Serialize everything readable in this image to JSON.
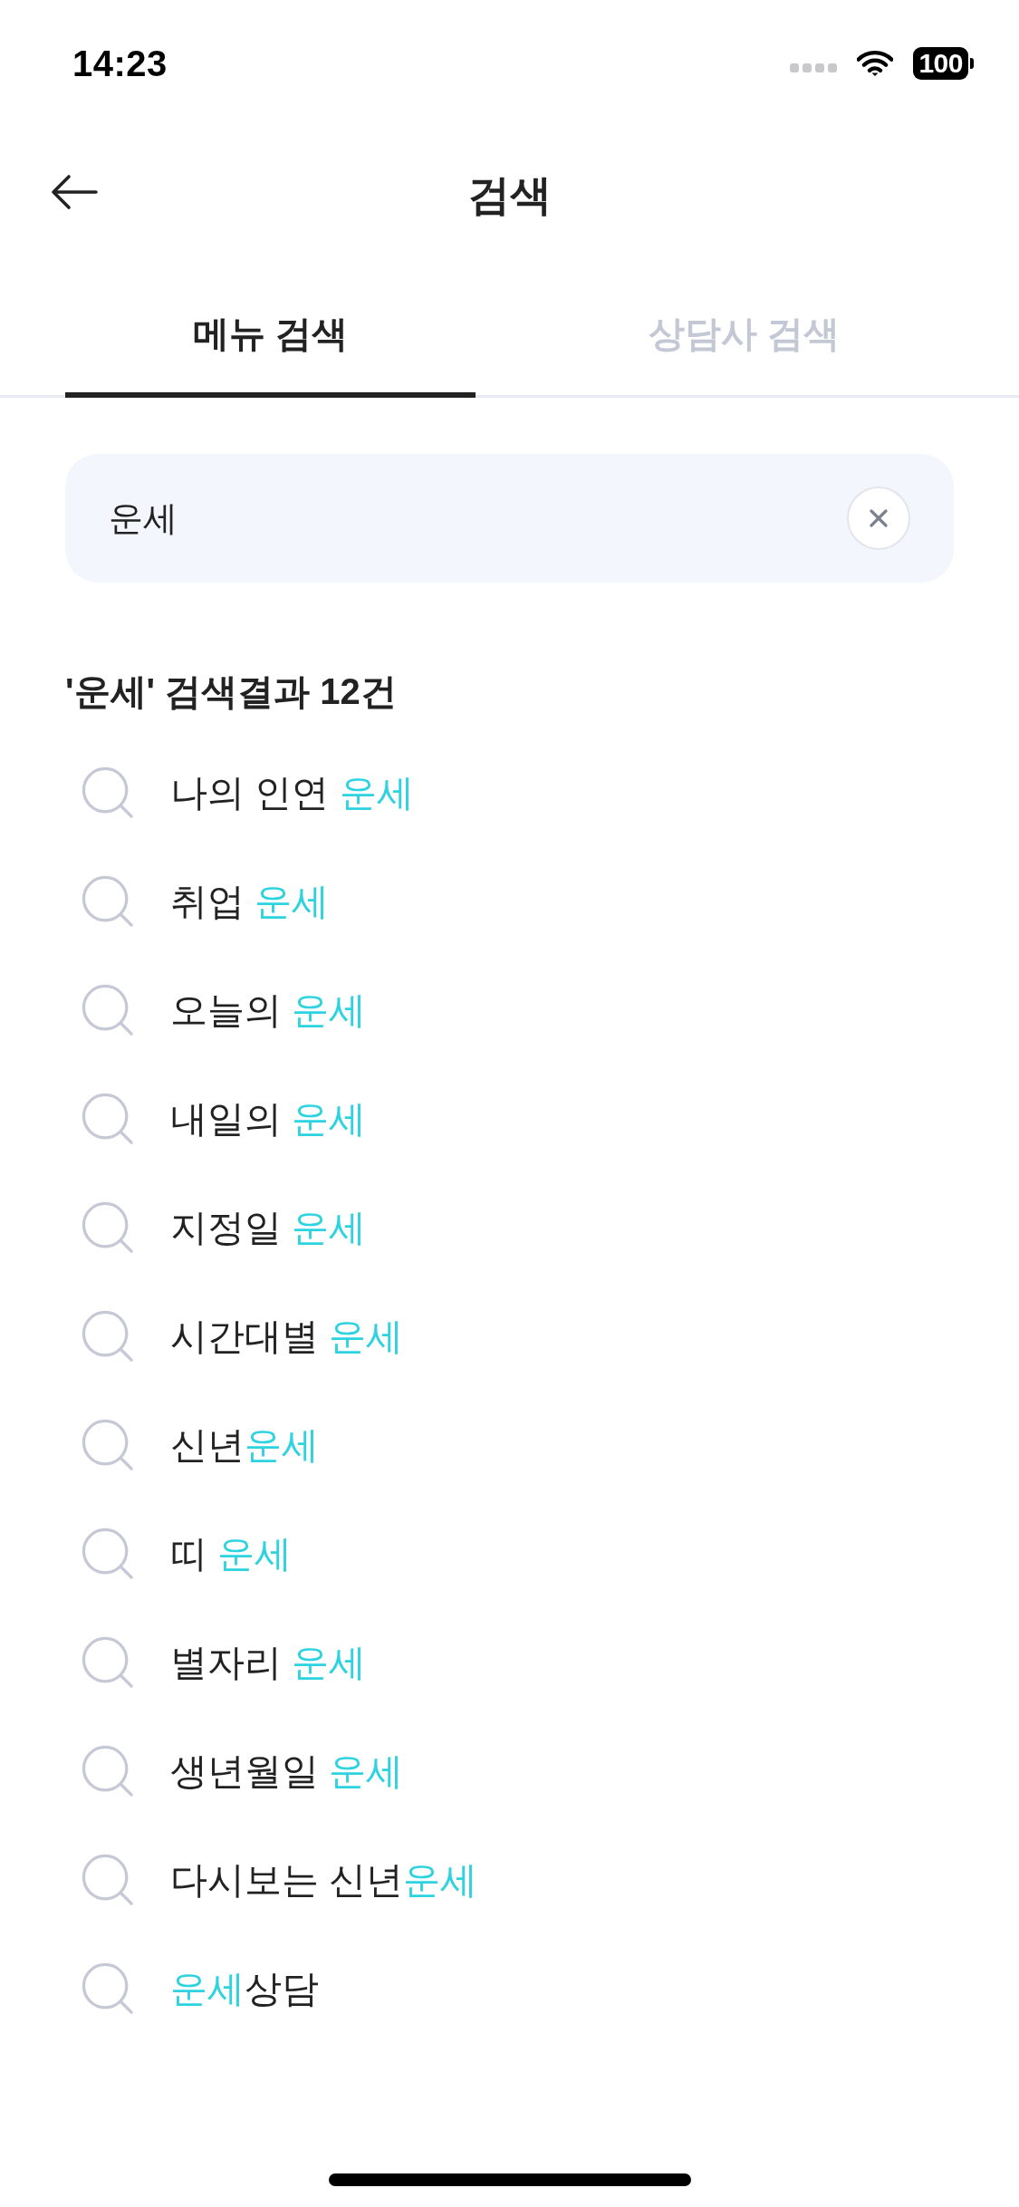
{
  "status_bar": {
    "time": "14:23",
    "battery": "100"
  },
  "header": {
    "title": "검색"
  },
  "tabs": [
    {
      "label": "메뉴 검색",
      "selected": true
    },
    {
      "label": "상담사 검색",
      "selected": false
    }
  ],
  "search": {
    "value": "운세"
  },
  "results": {
    "heading": "'운세' 검색결과 12건",
    "items": [
      {
        "segments": [
          {
            "text": "나의 인연 ",
            "match": false
          },
          {
            "text": "운세",
            "match": true
          }
        ]
      },
      {
        "segments": [
          {
            "text": "취업 ",
            "match": false
          },
          {
            "text": "운세",
            "match": true
          }
        ]
      },
      {
        "segments": [
          {
            "text": "오늘의 ",
            "match": false
          },
          {
            "text": "운세",
            "match": true
          }
        ]
      },
      {
        "segments": [
          {
            "text": "내일의 ",
            "match": false
          },
          {
            "text": "운세",
            "match": true
          }
        ]
      },
      {
        "segments": [
          {
            "text": "지정일 ",
            "match": false
          },
          {
            "text": "운세",
            "match": true
          }
        ]
      },
      {
        "segments": [
          {
            "text": "시간대별 ",
            "match": false
          },
          {
            "text": "운세",
            "match": true
          }
        ]
      },
      {
        "segments": [
          {
            "text": "신년",
            "match": false
          },
          {
            "text": "운세",
            "match": true
          }
        ]
      },
      {
        "segments": [
          {
            "text": "띠 ",
            "match": false
          },
          {
            "text": "운세",
            "match": true
          }
        ]
      },
      {
        "segments": [
          {
            "text": "별자리 ",
            "match": false
          },
          {
            "text": "운세",
            "match": true
          }
        ]
      },
      {
        "segments": [
          {
            "text": "생년월일 ",
            "match": false
          },
          {
            "text": "운세",
            "match": true
          }
        ]
      },
      {
        "segments": [
          {
            "text": "다시보는 신년",
            "match": false
          },
          {
            "text": "운세",
            "match": true
          }
        ]
      },
      {
        "segments": [
          {
            "text": "운세",
            "match": true
          },
          {
            "text": "상담",
            "match": false
          }
        ]
      }
    ]
  }
}
